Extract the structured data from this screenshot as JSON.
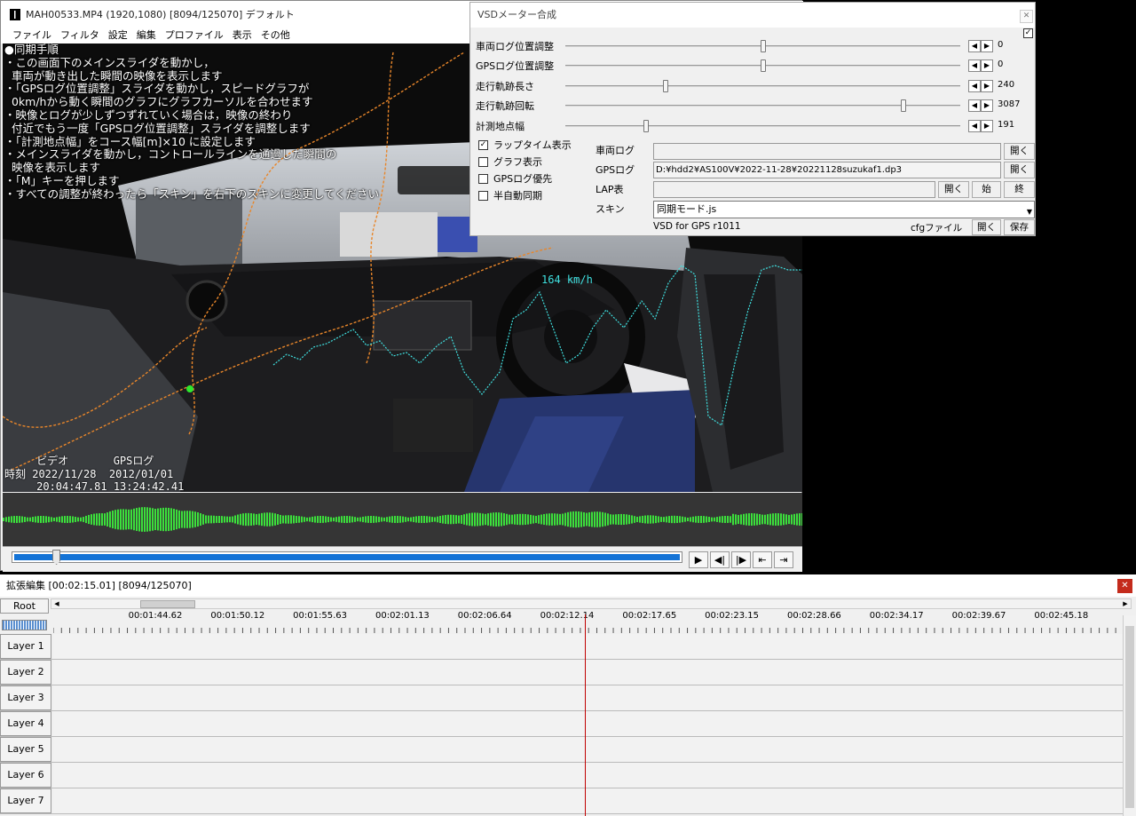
{
  "main_window": {
    "title": "MAH00533.MP4 (1920,1080)  [8094/125070]  デフォルト",
    "menu": [
      "ファイル",
      "フィルタ",
      "設定",
      "編集",
      "プロファイル",
      "表示",
      "その他"
    ]
  },
  "video": {
    "instructions": "●同期手順\n・この画面下のメインスライダを動かし，\n  車両が動き出した瞬間の映像を表示します\n・「GPSログ位置調整」スライダを動かし，スピードグラフが\n  0km/hから動く瞬間のグラフにグラフカーソルを合わせます\n・映像とログが少しずつずれていく場合は，映像の終わり\n  付近でもう一度「GPSログ位置調整」スライダを調整します\n・「計測地点幅」をコース幅[m]×10 に設定します\n・メインスライダを動かし，コントロールラインを通過した瞬間の\n  映像を表示します\n・「M」キーを押します\n・すべての調整が終わったら「スキン」を右下のスキンに変更してください",
    "time_header": "     ビデオ       GPSログ",
    "time_date": "時刻 2022/11/28  2012/01/01",
    "time_clock": "     20:04:47.81 13:24:42.41",
    "speed": "164 km/h"
  },
  "playback": {
    "progress_fraction": 0.065,
    "buttons": [
      "▶",
      "◀|",
      "|▶",
      "⇤",
      "⇥"
    ]
  },
  "vsd": {
    "title": "VSDメーター合成",
    "close": "✕",
    "top_check": "✓",
    "sliders": [
      {
        "label": "車両ログ位置調整",
        "value": "0",
        "fraction": 0.5
      },
      {
        "label": "GPSログ位置調整",
        "value": "0",
        "fraction": 0.5
      },
      {
        "label": "走行軌跡長さ",
        "value": "240",
        "fraction": 0.25
      },
      {
        "label": "走行軌跡回転",
        "value": "3087",
        "fraction": 0.86
      },
      {
        "label": "計測地点幅",
        "value": "191",
        "fraction": 0.2
      }
    ],
    "checkboxes": [
      {
        "label": "ラップタイム表示",
        "checked": true
      },
      {
        "label": "グラフ表示",
        "checked": false
      },
      {
        "label": "GPSログ優先",
        "checked": false
      },
      {
        "label": "半自動同期",
        "checked": false
      }
    ],
    "vehicle_log_label": "車両ログ",
    "vehicle_log_value": "",
    "gps_log_label": "GPSログ",
    "gps_log_value": "D:¥hdd2¥AS100V¥2022-11-28¥20221128suzukaf1.dp3",
    "lap_label": "LAP表",
    "lap_value": "",
    "skin_label": "スキン",
    "skin_value": "同期モード.js",
    "open_label": "開く",
    "start_label": "始",
    "end_label": "終",
    "version": "VSD for GPS r1011",
    "cfg_label": "cfgファイル",
    "save_label": "保存"
  },
  "timeline": {
    "title": "拡張編集 [00:02:15.01] [8094/125070]",
    "close": "✕",
    "root": "Root",
    "ticks": [
      "00:01:44.62",
      "00:01:50.12",
      "00:01:55.63",
      "00:02:01.13",
      "00:02:06.64",
      "00:02:12.14",
      "00:02:17.65",
      "00:02:23.15",
      "00:02:28.66",
      "00:02:34.17",
      "00:02:39.67",
      "00:02:45.18"
    ],
    "layers": [
      "Layer 1",
      "Layer 2",
      "Layer 3",
      "Layer 4",
      "Layer 5",
      "Layer 6",
      "Layer 7"
    ]
  },
  "colors": {
    "waveform": "#3ce03c",
    "progress": "#1473d6",
    "speed_graph": "#3fe0e0",
    "track": "#e8862a",
    "cursor": "#c00000"
  }
}
